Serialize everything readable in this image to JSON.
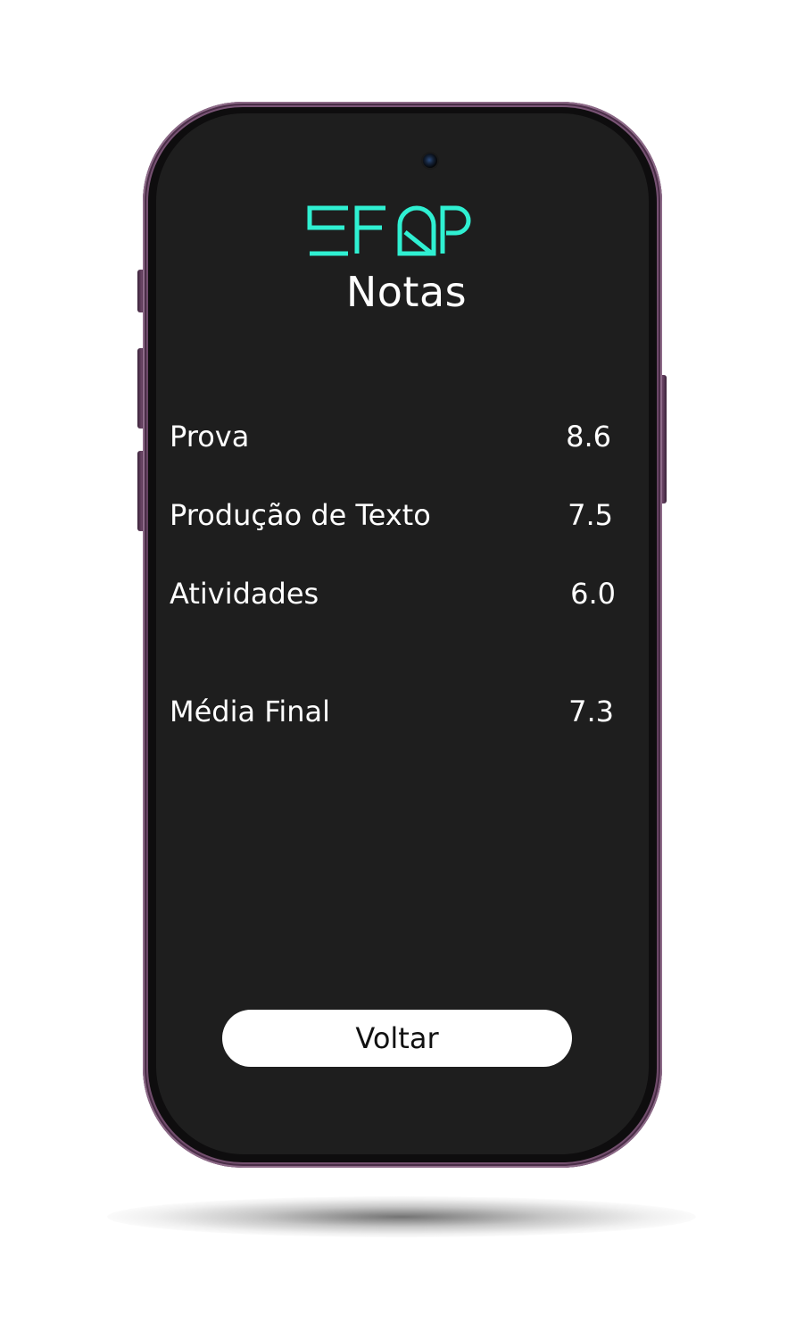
{
  "app": {
    "logo_text": "EFQP",
    "brand_color": "#2FF0D2"
  },
  "header": {
    "title": "Notas"
  },
  "grades": [
    {
      "label": "Prova",
      "value": "8.6"
    },
    {
      "label": "Produção de Texto",
      "value": "7.5"
    },
    {
      "label": "Atividades",
      "value": "6.0"
    }
  ],
  "summary": {
    "label": "Média Final",
    "value": "7.3"
  },
  "actions": {
    "back_label": "Voltar"
  },
  "theme": {
    "screen_background": "#1E1E1E",
    "text_color": "#FFFFFF",
    "button_background": "#FFFFFF",
    "frame_color": "#5B3A58"
  }
}
